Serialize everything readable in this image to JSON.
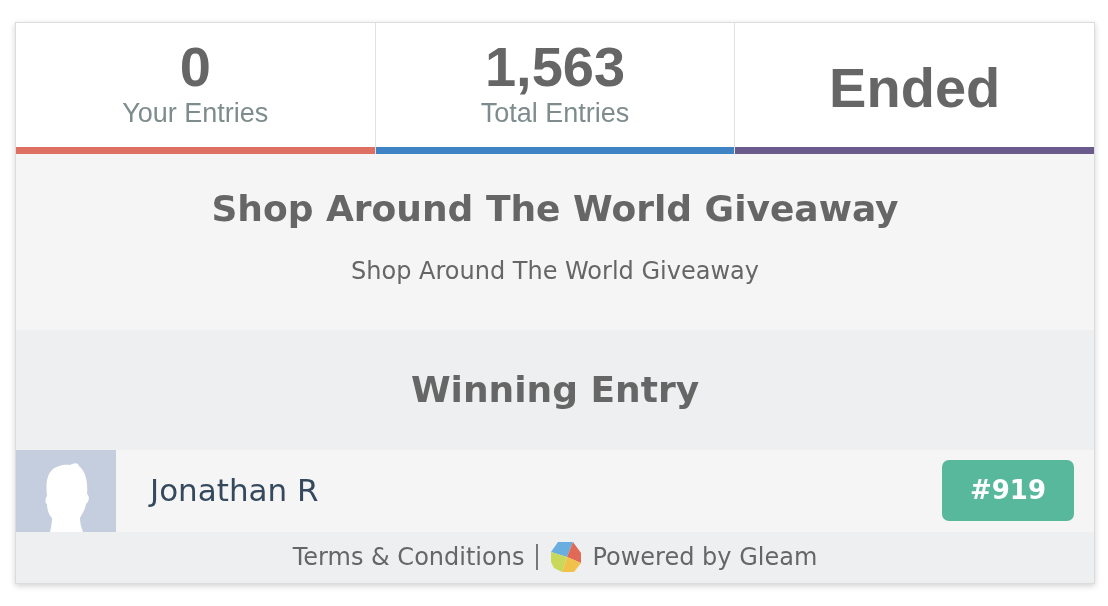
{
  "stats": [
    {
      "value": "0",
      "label": "Your Entries",
      "color": "#dd6f63"
    },
    {
      "value": "1,563",
      "label": "Total Entries",
      "color": "#4083c4"
    },
    {
      "value": "Ended",
      "color": "#6a5b8c"
    }
  ],
  "campaign": {
    "title": "Shop Around The World Giveaway",
    "description": "Shop Around The World Giveaway"
  },
  "winners": {
    "heading": "Winning Entry",
    "entries": [
      {
        "name": "Jonathan R",
        "entry": "#919"
      }
    ]
  },
  "footer": {
    "terms": "Terms & Conditions",
    "powered": "Powered by Gleam"
  }
}
